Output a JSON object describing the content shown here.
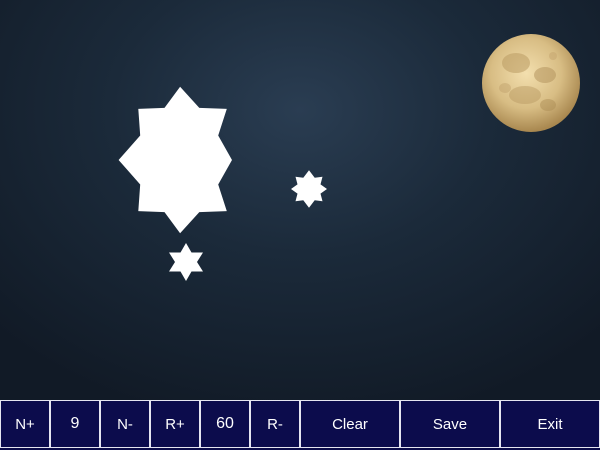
{
  "toolbar": {
    "n_plus": "N+",
    "n_value": "9",
    "n_minus": "N-",
    "r_plus": "R+",
    "r_value": "60",
    "r_minus": "R-",
    "clear": "Clear",
    "save": "Save",
    "exit": "Exit"
  },
  "colors": {
    "toolbar_bg": "#0c0c4c",
    "button_border": "#e6e6f0",
    "star_fill": "#ffffff",
    "moon": "#d9c08a"
  }
}
